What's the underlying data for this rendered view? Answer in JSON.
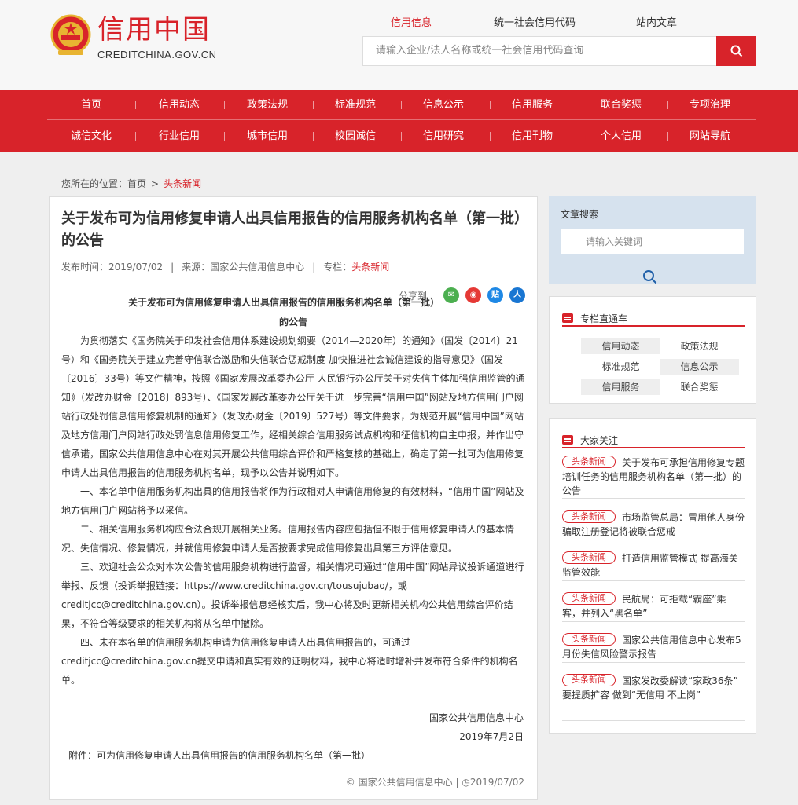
{
  "header": {
    "logo_cn": "信用中国",
    "logo_en": "CREDITCHINA.GOV.CN",
    "search_tabs": [
      "信用信息",
      "统一社会信用代码",
      "站内文章"
    ],
    "search_placeholder": "请输入企业/法人名称或统一社会信用代码查询"
  },
  "nav": {
    "row1": [
      "首页",
      "信用动态",
      "政策法规",
      "标准规范",
      "信息公示",
      "信用服务",
      "联合奖惩",
      "专项治理"
    ],
    "row2": [
      "诚信文化",
      "行业信用",
      "城市信用",
      "校园诚信",
      "信用研究",
      "信用刊物",
      "个人信用",
      "网站导航"
    ]
  },
  "breadcrumb": {
    "label": "您所在的位置：",
    "home": "首页",
    "sep": ">",
    "current": "头条新闻"
  },
  "article": {
    "title": "关于发布可为信用修复申请人出具信用报告的信用服务机构名单（第一批）的公告",
    "publish": "发布时间：2019/07/02",
    "source": "来源：国家公共信用信息中心",
    "column_label": "专栏：",
    "column": "头条新闻",
    "share_label": "分享到",
    "doc_heading_1": "关于发布可为信用修复申请人出具信用报告的信用服务机构名单（第一批）",
    "doc_heading_2": "的公告",
    "paragraphs": [
      "为贯彻落实《国务院关于印发社会信用体系建设规划纲要（2014—2020年）的通知》（国发〔2014〕21号）和《国务院关于建立完善守信联合激励和失信联合惩戒制度 加快推进社会诚信建设的指导意见》（国发〔2016〕33号）等文件精神，按照《国家发展改革委办公厅 人民银行办公厅关于对失信主体加强信用监管的通知》（发改办财金〔2018〕893号）、《国家发展改革委办公厅关于进一步完善“信用中国”网站及地方信用门户网站行政处罚信息信用修复机制的通知》（发改办财金〔2019〕527号）等文件要求，为规范开展“信用中国”网站及地方信用门户网站行政处罚信息信用修复工作，经相关综合信用服务试点机构和征信机构自主申报，并作出守信承诺，国家公共信用信息中心在对其开展公共信用综合评价和严格复核的基础上，确定了第一批可为信用修复申请人出具信用报告的信用服务机构名单，现予以公告并说明如下。",
      "一、本名单中信用服务机构出具的信用报告将作为行政相对人申请信用修复的有效材料，“信用中国”网站及地方信用门户网站将予以采信。",
      "二、相关信用服务机构应合法合规开展相关业务。信用报告内容应包括但不限于信用修复申请人的基本情况、失信情况、修复情况，并就信用修复申请人是否按要求完成信用修复出具第三方评估意见。",
      "三、欢迎社会公众对本次公告的信用服务机构进行监督，相关情况可通过“信用中国”网站异议投诉通道进行举报、反馈（投诉举报链接：https://www.creditchina.gov.cn/tousujubao/，或creditjcc@creditchina.gov.cn）。投诉举报信息经核实后，我中心将及时更新相关机构公共信用综合评价结果，不符合等级要求的相关机构将从名单中撤除。",
      "四、未在本名单的信用服务机构申请为信用修复申请人出具信用报告的，可通过creditjcc@creditchina.gov.cn提交申请和真实有效的证明材料，我中心将适时增补并发布符合条件的机构名单。"
    ],
    "signature": "国家公共信用信息中心",
    "date": "2019年7月2日",
    "attachment_label": "附件：",
    "attachment": "可为信用修复申请人出具信用报告的信用服务机构名单（第一批）",
    "footer_source": "国家公共信用信息中心",
    "footer_date": "2019/07/02",
    "footer_sep": "|"
  },
  "sidebar": {
    "search_title": "文章搜索",
    "search_placeholder": "请输入关键词",
    "column_title": "专栏直通车",
    "columns": [
      "信用动态",
      "政策法规",
      "标准规范",
      "信息公示",
      "信用服务",
      "联合奖惩"
    ],
    "focus_title": "大家关注",
    "news_tag": "头条新闻",
    "news": [
      "关于发布可承担信用修复专题培训任务的信用服务机构名单（第一批）的公告",
      "市场监管总局：冒用他人身份骗取注册登记将被联合惩戒",
      "打造信用监管模式 提高海关监管效能",
      "民航局：可拒载“霸座”乘客，并列入“黑名单”",
      "国家公共信用信息中心发布5月份失信风险警示报告",
      "国家发改委解读“家政36条” 要提质扩容 做到“无信用 不上岗”"
    ]
  },
  "colors": {
    "brand_red": "#d8232a",
    "sidebar_blue": "#d6e2ee"
  },
  "icons": [
    "national-emblem-icon",
    "search-icon",
    "wechat-icon",
    "weibo-icon",
    "tieba-icon",
    "renren-icon",
    "column-icon"
  ]
}
